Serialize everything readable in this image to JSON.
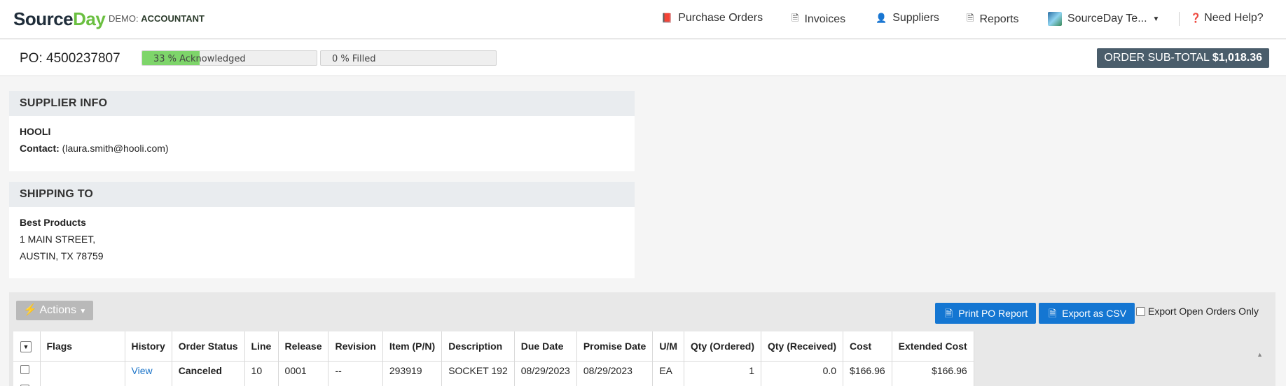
{
  "logo": {
    "part1": "Source",
    "part2": "Day"
  },
  "demo": {
    "prefix": "DEMO:",
    "role": "ACCOUNTANT"
  },
  "nav": [
    {
      "label": "Purchase Orders",
      "icon": "book-icon"
    },
    {
      "label": "Invoices",
      "icon": "invoice-icon"
    },
    {
      "label": "Suppliers",
      "icon": "contact-icon"
    },
    {
      "label": "Reports",
      "icon": "report-icon"
    }
  ],
  "account": {
    "label": "SourceDay Te..."
  },
  "help": {
    "label": "Need Help?"
  },
  "po": {
    "title": "PO: 4500237807",
    "ack": {
      "text": "33 % Acknowledged",
      "value": 0.33
    },
    "filled": {
      "text": "0 % Filled",
      "value": 0
    },
    "subtotal_label": "ORDER SUB-TOTAL",
    "subtotal_value": "$1,018.36"
  },
  "supplier": {
    "heading": "SUPPLIER INFO",
    "name": "HOOLI",
    "contact_label": "Contact:",
    "contact_value": "(laura.smith@hooli.com)"
  },
  "shipping": {
    "heading": "SHIPPING TO",
    "name": "Best Products",
    "line1": "1 MAIN STREET,",
    "line2": "AUSTIN, TX 78759"
  },
  "toolbar": {
    "actions": "Actions",
    "print": "Print PO Report",
    "export": "Export as CSV",
    "export_open": "Export Open Orders Only"
  },
  "table": {
    "headers": [
      "Flags",
      "History",
      "Order Status",
      "Line",
      "Release",
      "Revision",
      "Item (P/N)",
      "Description",
      "Due Date",
      "Promise Date",
      "U/M",
      "Qty (Ordered)",
      "Qty (Received)",
      "Cost",
      "Extended Cost"
    ],
    "rows": [
      {
        "flags": "",
        "history": "View",
        "status": "Canceled",
        "line": "10",
        "release": "0001",
        "revision": "--",
        "item": "293919",
        "description": "SOCKET 192",
        "due": "08/29/2023",
        "promise": "08/29/2023",
        "um": "EA",
        "qty_ordered": "1",
        "qty_received": "0.0",
        "cost": "$166.96",
        "extended": "$166.96"
      }
    ]
  },
  "colors": {
    "brand_green": "#6abf40",
    "progress_fill": "#7ed56a",
    "button_blue": "#1476d2",
    "subtotal_bg": "#4a5d6b"
  }
}
